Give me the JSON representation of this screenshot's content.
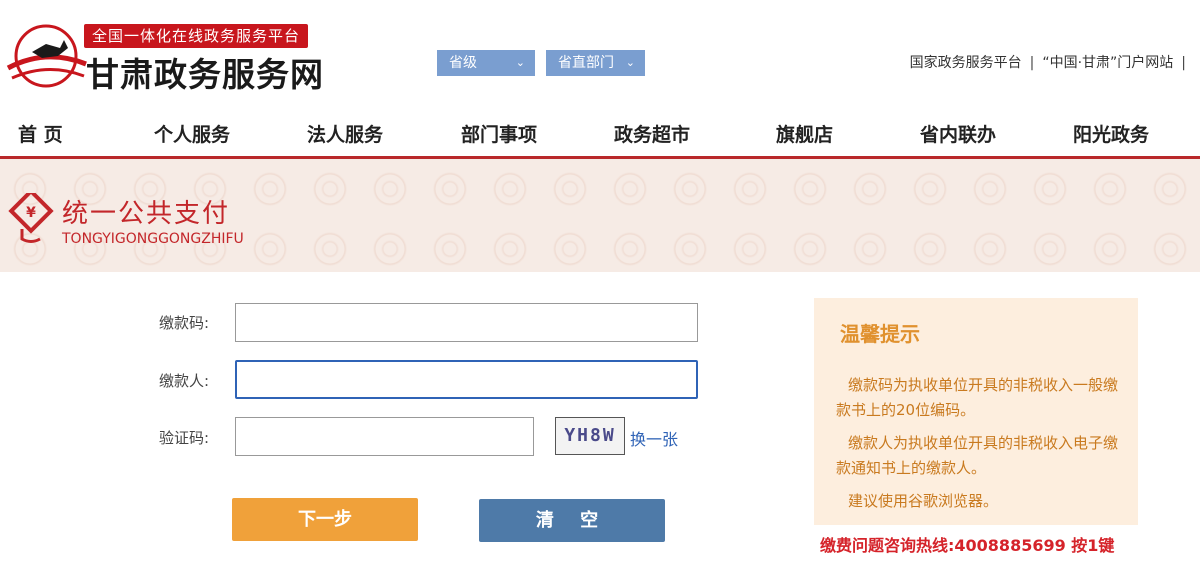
{
  "header": {
    "banner_text": "全国一体化在线政务服务平台",
    "site_title": "甘肃政务服务网",
    "region_selects": [
      "省级",
      "省直部门"
    ],
    "top_links": [
      "国家政务服务平台",
      "“中国·甘肃”门户网站"
    ]
  },
  "nav": {
    "items": [
      "首 页",
      "个人服务",
      "法人服务",
      "部门事项",
      "政务超市",
      "旗舰店",
      "省内联办",
      "阳光政务"
    ]
  },
  "banner": {
    "title": "统一公共支付",
    "subtitle": "TONGYIGONGGONGZHIFU"
  },
  "form": {
    "payment_code_label": "缴款码:",
    "payment_code_value": "",
    "payer_label": "缴款人:",
    "payer_value": "",
    "captcha_label": "验证码:",
    "captcha_value": "",
    "captcha_image_text": "YH8W",
    "refresh_label": "换一张",
    "next_label": "下一步",
    "clear_label": "清 空"
  },
  "tips": {
    "title": "温馨提示",
    "lines": [
      "缴款码为执收单位开具的非税收入一般缴款书上的20位编码。",
      "缴款人为执收单位开具的非税收入电子缴款通知书上的缴款人。",
      "建议使用谷歌浏览器。"
    ],
    "hotline": "缴费问题咨询热线:4008885699 按1键"
  },
  "colors": {
    "brand_red": "#c8161d",
    "select_blue": "#7a9ed0",
    "next_orange": "#f0a13a",
    "clear_blue": "#4e7aa8",
    "tips_bg": "#fdeede",
    "tips_text": "#c97a1f"
  },
  "icons": [
    "horse-logo-icon",
    "chevron-down-icon",
    "payment-emblem-icon"
  ]
}
